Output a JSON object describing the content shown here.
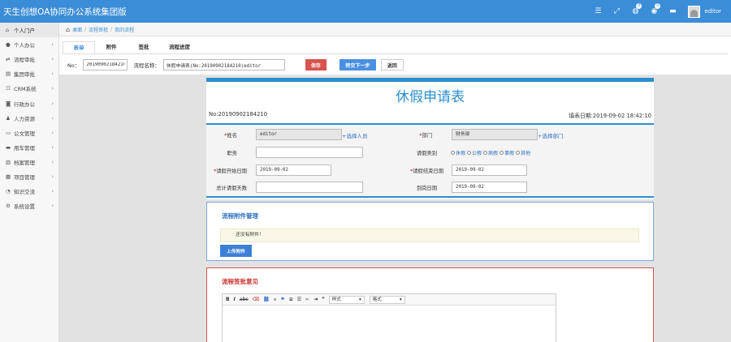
{
  "app": {
    "title": "天生创想OA协同办公系统集团版"
  },
  "header": {
    "icons": [
      {
        "name": "menu-icon",
        "glyph": "☰",
        "badge": ""
      },
      {
        "name": "fullscreen-icon",
        "glyph": "⤢",
        "badge": ""
      },
      {
        "name": "chat-icon",
        "glyph": "💬",
        "badge": "0"
      },
      {
        "name": "notice-icon",
        "glyph": "🔔",
        "badge": "0"
      },
      {
        "name": "message-icon",
        "glyph": "✉",
        "badge": ""
      }
    ],
    "username": "editor"
  },
  "sidebar": {
    "items": [
      {
        "label": "个人门户",
        "icon": "home-icon",
        "glyph": "⌂",
        "active": true
      },
      {
        "label": "个人办公",
        "icon": "user-icon",
        "glyph": "●"
      },
      {
        "label": "流程审批",
        "icon": "flow-icon",
        "glyph": "⇄"
      },
      {
        "label": "集团审批",
        "icon": "group-icon",
        "glyph": "▤"
      },
      {
        "label": "CRM系统",
        "icon": "crm-icon",
        "glyph": "☷"
      },
      {
        "label": "行政办公",
        "icon": "admin-icon",
        "glyph": "◙"
      },
      {
        "label": "人力资源",
        "icon": "hr-icon",
        "glyph": "♟"
      },
      {
        "label": "公文管理",
        "icon": "folder-icon",
        "glyph": "▭"
      },
      {
        "label": "用车管理",
        "icon": "car-icon",
        "glyph": "▬"
      },
      {
        "label": "档案管理",
        "icon": "archive-icon",
        "glyph": "▥"
      },
      {
        "label": "项目管理",
        "icon": "project-icon",
        "glyph": "▦"
      },
      {
        "label": "知识交流",
        "icon": "knowledge-icon",
        "glyph": "◔"
      },
      {
        "label": "系统设置",
        "icon": "settings-icon",
        "glyph": "⚙"
      }
    ]
  },
  "breadcrumb": {
    "items": [
      "桌面",
      "流程审批",
      "我的流程"
    ]
  },
  "tabs": [
    "表单",
    "附件",
    "签批",
    "流程进度"
  ],
  "formbar": {
    "no_label": "No：",
    "no_value": "20190902184210",
    "name_label": "流程名称：",
    "name_value": "休假申请表(No:20190902184210)editor",
    "save": "保存",
    "next": "转交下一步",
    "back": "返回"
  },
  "form": {
    "title": "休假申请表",
    "no": "No:20190902184210",
    "date": "填表日期:2019-09-02 18:42:10",
    "name_label": "姓名",
    "name_value": "editor",
    "pick_person": "+选择人员",
    "dept_label": "部门",
    "dept_value": "财务部",
    "pick_dept": "+选择部门",
    "position_label": "职务",
    "type_label": "请假类别",
    "leave_types": [
      "休假",
      "公假",
      "病假",
      "事假",
      "其他"
    ],
    "start_label": "请假开始日期",
    "start_value": "2019-09-02",
    "end_label": "请假结束日期",
    "end_value": "2019-09-02",
    "days_label": "总计请假天数",
    "return_label": "到岗日期",
    "return_value": "2019-09-02"
  },
  "attachments": {
    "title": "流程附件管理",
    "empty_note": "还没有附件！",
    "upload": "上传附件"
  },
  "opinion": {
    "title": "流程签批意见",
    "style_select": "样式",
    "format_select": "格式"
  },
  "colors": {
    "header": "#3c8dd8",
    "accent": "#2b8fcf",
    "danger": "#d9534f"
  }
}
